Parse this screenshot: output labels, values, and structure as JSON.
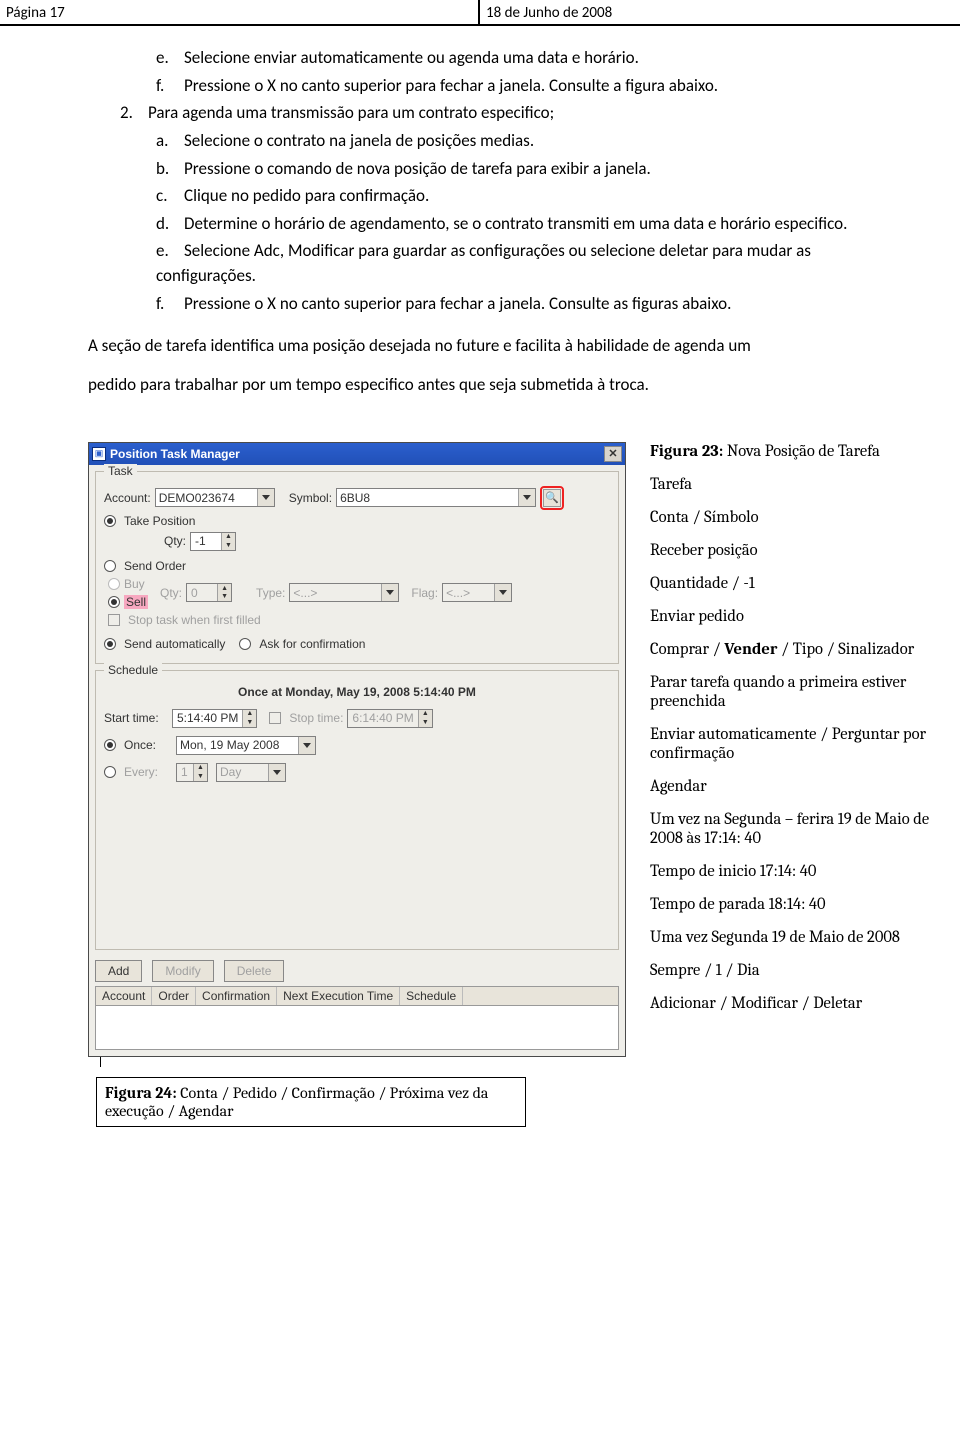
{
  "header": {
    "left": "Página 17",
    "right": "18 de Junho de 2008"
  },
  "list": {
    "e": "Selecione enviar automaticamente ou agenda uma data e horário.",
    "f": "Pressione o X no canto superior para fechar a janela. Consulte a figura abaixo.",
    "n2": "Para agenda uma transmissão para um contrato especifico;",
    "a": "Selecione o contrato na janela de posições medias.",
    "b": "Pressione o comando de nova posição de tarefa para exibir a janela.",
    "c": "Clique no pedido para confirmação.",
    "d": "Determine o horário de agendamento, se o contrato transmiti em uma data e horário especifico.",
    "e2": "Selecione Adc, Modificar para guardar as configurações ou selecione deletar para mudar as configurações.",
    "f2": "Pressione o X no canto superior para fechar a janela. Consulte as figuras abaixo."
  },
  "para1": "A seção de tarefa identifica uma posição desejada no future e facilita à habilidade de agenda um",
  "para2": "pedido para trabalhar por um tempo especifico antes que seja submetida à troca.",
  "dialog": {
    "title": "Position Task Manager",
    "task": "Task",
    "account_lbl": "Account:",
    "account_val": "DEMO023674",
    "symbol_lbl": "Symbol:",
    "symbol_val": "6BU8",
    "take_position": "Take Position",
    "qty_lbl": "Qty:",
    "qty_val": "-1",
    "send_order": "Send Order",
    "buy": "Buy",
    "sell": "Sell",
    "qty2_val": "0",
    "type_lbl": "Type:",
    "type_val": "<...>",
    "flag_lbl": "Flag:",
    "flag_val": "<...>",
    "stop_task": "Stop task when first filled",
    "send_auto": "Send automatically",
    "ask_conf": "Ask for confirmation",
    "schedule": "Schedule",
    "sched_title": "Once at Monday, May 19, 2008 5:14:40 PM",
    "start_lbl": "Start time:",
    "start_val": "5:14:40 PM",
    "stop_lbl": "Stop time:",
    "stop_val": "6:14:40 PM",
    "once_lbl": "Once:",
    "once_val": "Mon, 19 May 2008",
    "every_lbl": "Every:",
    "every_n": "1",
    "every_unit": "Day",
    "add": "Add",
    "modify": "Modify",
    "delete": "Delete",
    "col_account": "Account",
    "col_order": "Order",
    "col_conf": "Confirmation",
    "col_next": "Next Execution Time",
    "col_sched": "Schedule"
  },
  "legend": {
    "fig23_label": "Figura 23:",
    "fig23_text": " Nova Posição de Tarefa",
    "l1": "Tarefa",
    "l2": "Conta / Símbolo",
    "l3": "Receber posição",
    "l4": "Quantidade / -1",
    "l5": "Enviar pedido",
    "l6a": "Comprar / ",
    "l6b": "Vender",
    "l6c": " / Tipo / Sinalizador",
    "l7": "Parar tarefa quando a primeira estiver preenchida",
    "l8": "Enviar automaticamente / Perguntar por confirmação",
    "l9": "Agendar",
    "l10": "Um vez na Segunda – ferira 19 de Maio de 2008 às 17:14: 40",
    "l11": "Tempo de inicio 17:14: 40",
    "l12": "Tempo de parada 18:14: 40",
    "l13": "Uma vez Segunda 19 de Maio de 2008",
    "l14": "Sempre / 1 / Dia",
    "l15": "Adicionar / Modificar / Deletar"
  },
  "caption": {
    "fig24_label": "Figura 24:",
    "fig24_text": " Conta / Pedido / Confirmação / Próxima vez da execução / Agendar"
  }
}
